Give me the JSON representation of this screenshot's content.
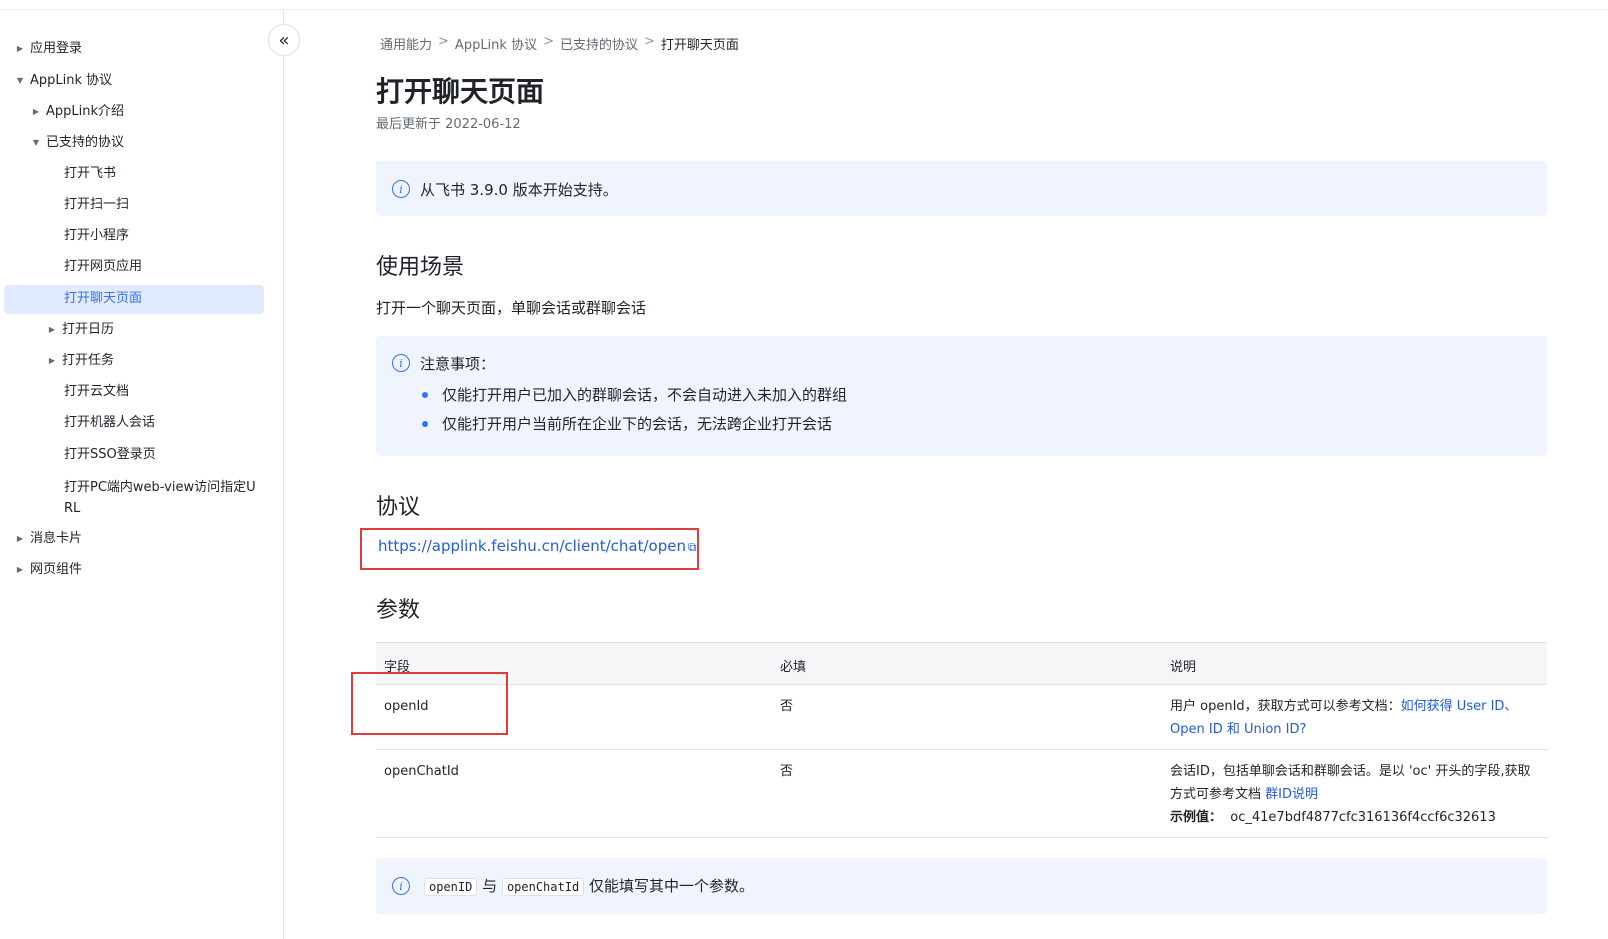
{
  "sidebar": {
    "collapse_label": "«",
    "items": [
      {
        "label": "应用登录",
        "caret": "▶"
      },
      {
        "label": "AppLink 协议",
        "caret": "▼"
      },
      {
        "label": "AppLink介绍",
        "caret": "▶"
      },
      {
        "label": "已支持的协议",
        "caret": "▼"
      },
      {
        "label": "打开飞书",
        "caret": ""
      },
      {
        "label": "打开扫一扫",
        "caret": ""
      },
      {
        "label": "打开小程序",
        "caret": ""
      },
      {
        "label": "打开网页应用",
        "caret": ""
      },
      {
        "label": "打开聊天页面",
        "caret": ""
      },
      {
        "label": "打开日历",
        "caret": "▶"
      },
      {
        "label": "打开任务",
        "caret": "▶"
      },
      {
        "label": "打开云文档",
        "caret": ""
      },
      {
        "label": "打开机器人会话",
        "caret": ""
      },
      {
        "label": "打开SSO登录页",
        "caret": ""
      },
      {
        "label": "打开PC端内web-view访问指定URL",
        "caret": ""
      },
      {
        "label": "消息卡片",
        "caret": "▶"
      },
      {
        "label": "网页组件",
        "caret": "▶"
      }
    ]
  },
  "breadcrumb": {
    "items": [
      "通用能力",
      "AppLink 协议",
      "已支持的协议",
      "打开聊天页面"
    ],
    "sep": ">"
  },
  "page": {
    "title": "打开聊天页面",
    "updated": "最后更新于 2022-06-12"
  },
  "callout_version": {
    "icon": "i",
    "text": "从飞书 3.9.0 版本开始支持。"
  },
  "section_usage": {
    "title": "使用场景",
    "text": "打开一个聊天页面，单聊会话或群聊会话"
  },
  "callout_notes": {
    "icon": "i",
    "title": "注意事项：",
    "bullets": [
      "仅能打开用户已加入的群聊会话，不会自动进入未加入的群组",
      "仅能打开用户当前所在企业下的会话，无法跨企业打开会话"
    ]
  },
  "section_protocol": {
    "title": "协议",
    "link": "https://applink.feishu.cn/client/chat/open",
    "ext_icon": "⧉"
  },
  "section_params": {
    "title": "参数",
    "headers": [
      "字段",
      "必填",
      "说明"
    ],
    "rows": [
      {
        "field": "openId",
        "required": "否",
        "desc_prefix": "用户 openId，获取方式可以参考文档：",
        "desc_link": "如何获得 User ID、Open ID 和 Union ID?"
      },
      {
        "field": "openChatId",
        "required": "否",
        "desc_prefix": "会话ID，包括单聊会话和群聊会话。是以 'oc' 开头的字段,获取方式可参考文档",
        "desc_link": "群ID说明",
        "example_label": "示例值：",
        "example_value": "oc_41e7bdf4877cfc316136f4ccf6c32613"
      }
    ]
  },
  "callout_bottom": {
    "icon": "i",
    "code1": "openID",
    "mid": "与",
    "code2": "openChatId",
    "suffix": "仅能填写其中一个参数。"
  },
  "colors": {
    "accent": "#3370ff",
    "link": "#245bdb",
    "highlight": "#e23b3b",
    "callout_bg": "#f0f4ff",
    "active_bg": "#e1eaff"
  }
}
